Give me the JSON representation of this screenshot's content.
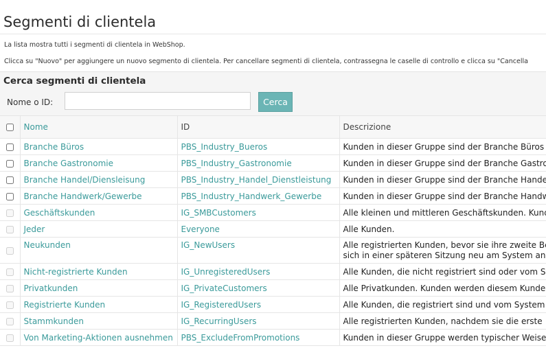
{
  "page": {
    "title": "Segmenti di clientela",
    "intro_line1": "La lista mostra tutti i segmenti di clientela in  WebShop.",
    "intro_line2": "Clicca su \"Nuovo\" per aggiungere un nuovo segmento di clientela. Per cancellare segmenti di clientela, contrassegna le caselle di controllo e clicca su \"Cancella"
  },
  "search": {
    "heading": "Cerca segmenti di clientela",
    "label": "Nome o ID:",
    "value": "",
    "placeholder": "",
    "button_label": "Cerca"
  },
  "table": {
    "columns": {
      "name": "Nome",
      "id": "ID",
      "description": "Descrizione"
    },
    "rows": [
      {
        "name": "Branche Büros",
        "id": "PBS_Industry_Bueros",
        "description": "Kunden in dieser Gruppe sind der Branche Büros z"
      },
      {
        "name": "Branche Gastronomie",
        "id": "PBS_Industry_Gastronomie",
        "description": "Kunden in dieser Gruppe sind der Branche Gastron"
      },
      {
        "name": "Branche Handel/Diensleisung",
        "id": "PBS_Industry_Handel_Dienstleistung",
        "description": "Kunden in dieser Gruppe sind der Branche Handel/"
      },
      {
        "name": "Branche Handwerk/Gewerbe",
        "id": "PBS_Industry_Handwerk_Gewerbe",
        "description": "Kunden in dieser Gruppe sind der Branche Handw"
      },
      {
        "name": "Geschäftskunden",
        "id": "IG_SMBCustomers",
        "description": "Alle kleinen und mittleren Geschäftskunden. Kund"
      },
      {
        "name": "Jeder",
        "id": "Everyone",
        "description": "Alle Kunden."
      },
      {
        "name": "Neukunden",
        "id": "IG_NewUsers",
        "description": "Alle registrierten Kunden, bevor sie ihre zweite Be",
        "description2": "sich in einer späteren Sitzung neu am System ang"
      },
      {
        "name": "Nicht-registrierte Kunden",
        "id": "IG_UnregisteredUsers",
        "description": "Alle Kunden, die nicht registriert sind oder vom Sy"
      },
      {
        "name": "Privatkunden",
        "id": "IG_PrivateCustomers",
        "description": "Alle Privatkunden. Kunden werden diesem Kunde"
      },
      {
        "name": "Registrierte Kunden",
        "id": "IG_RegisteredUsers",
        "description": "Alle Kunden, die registriert sind und vom System"
      },
      {
        "name": "Stammkunden",
        "id": "IG_RecurringUsers",
        "description": "Alle registrierten Kunden, nachdem sie die erste"
      },
      {
        "name": "Von Marketing-Aktionen ausnehmen",
        "id": "PBS_ExcludeFromPromotions",
        "description": "Kunden in dieser Gruppe werden typischer Weise"
      }
    ]
  }
}
